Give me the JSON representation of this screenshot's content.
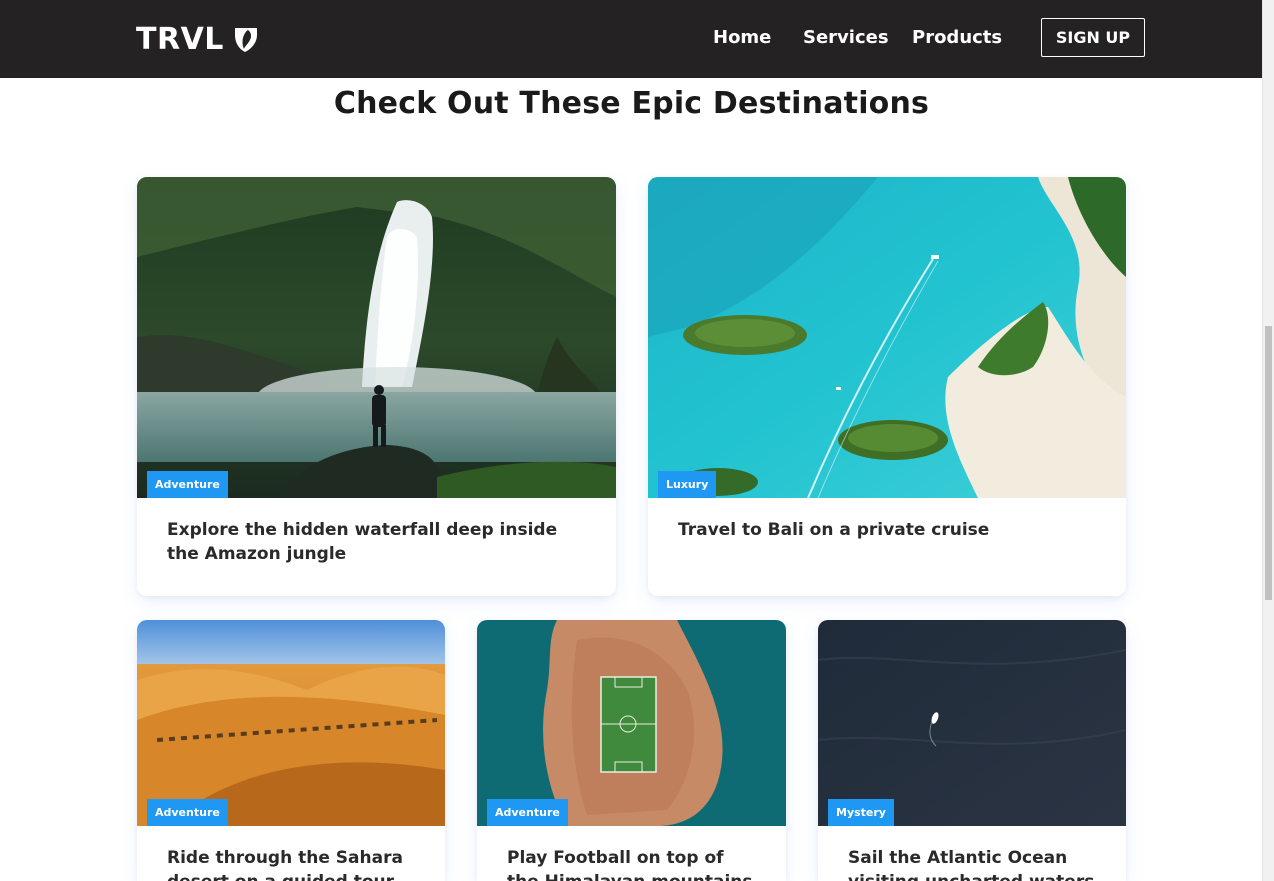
{
  "nav": {
    "logo_text": "TRVL",
    "logo_icon": "typo3-shield-icon",
    "links": [
      "Home",
      "Services",
      "Products"
    ],
    "signup_label": "SIGN UP"
  },
  "main": {
    "heading": "Check Out These Epic Destinations"
  },
  "cards": [
    {
      "tag": "Adventure",
      "title": "Explore the hidden waterfall deep inside the Amazon jungle",
      "image": "waterfall"
    },
    {
      "tag": "Luxury",
      "title": "Travel to Bali on a private cruise",
      "image": "aerial lagoon islands"
    },
    {
      "tag": "Adventure",
      "title": "Ride through the Sahara desert on a guided tour",
      "image": "desert camels"
    },
    {
      "tag": "Adventure",
      "title": "Play Football on top of the Himalayan mountains",
      "image": "island football field"
    },
    {
      "tag": "Mystery",
      "title": "Sail the Atlantic Ocean visiting uncharted waters",
      "image": "dark ocean boat"
    }
  ],
  "colors": {
    "navbar_bg": "#242222",
    "tag_bg": "#1f98f4",
    "heading_text": "#1a1a1a"
  }
}
